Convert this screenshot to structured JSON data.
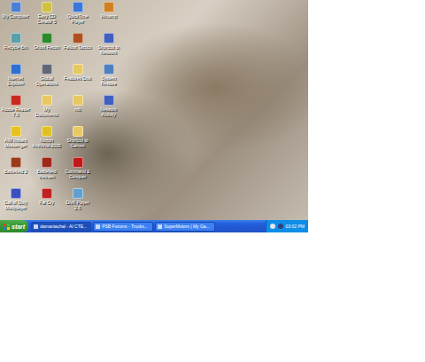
{
  "desktop": {
    "wallpaper": "photo",
    "icons": [
      {
        "label": "My Computer",
        "color": "#4a7fd4"
      },
      {
        "label": "Recycle Bin",
        "color": "#5aa0a8"
      },
      {
        "label": "Internet Explorer",
        "color": "#2f6fd0"
      },
      {
        "label": "Adobe Reader 7.0",
        "color": "#c8281e"
      },
      {
        "label": "AIM Instant Messenger",
        "color": "#e8c020"
      },
      {
        "label": "Battlefield 2",
        "color": "#9a3a1a"
      },
      {
        "label": "Call of Duty Multiplayer",
        "color": "#3a50c0"
      },
      {
        "label": "Easy CD Creator 5",
        "color": "#d0c040"
      },
      {
        "label": "Ghost Recon",
        "color": "#2a8a2a"
      },
      {
        "label": "Global Operations",
        "color": "#606878"
      },
      {
        "label": "My Documents",
        "color": "#e8c860"
      },
      {
        "label": "Norton AntiVirus 2005",
        "color": "#e0c020"
      },
      {
        "label": "Battlefield Vietnam",
        "color": "#a02818"
      },
      {
        "label": "Far Cry",
        "color": "#c02020"
      },
      {
        "label": "QuickTime Player",
        "color": "#3a78d8"
      },
      {
        "label": "Fallout Tactics",
        "color": "#b05020"
      },
      {
        "label": "Features Disk",
        "color": "#e8c860"
      },
      {
        "label": "mb",
        "color": "#e8c860"
      },
      {
        "label": "Shortcut to Games",
        "color": "#e8c860"
      },
      {
        "label": "Command & Conquer",
        "color": "#c01818"
      },
      {
        "label": "DivX Player 2.6",
        "color": "#60a0d0"
      },
      {
        "label": "Winamp",
        "color": "#d08020"
      },
      {
        "label": "Shortcut to Network",
        "color": "#4060c0"
      },
      {
        "label": "System Restore",
        "color": "#5080c0"
      },
      {
        "label": "Network Activity",
        "color": "#4060c0"
      }
    ]
  },
  "taskbar": {
    "start": "start",
    "tasks": [
      {
        "label": "damantachal - AI CTE...",
        "selected": true
      },
      {
        "label": "PSB Forums - Trucks...",
        "selected": false
      },
      {
        "label": "SuperMotors | My Ga...",
        "selected": false
      }
    ],
    "clock": "03:02 PM"
  }
}
